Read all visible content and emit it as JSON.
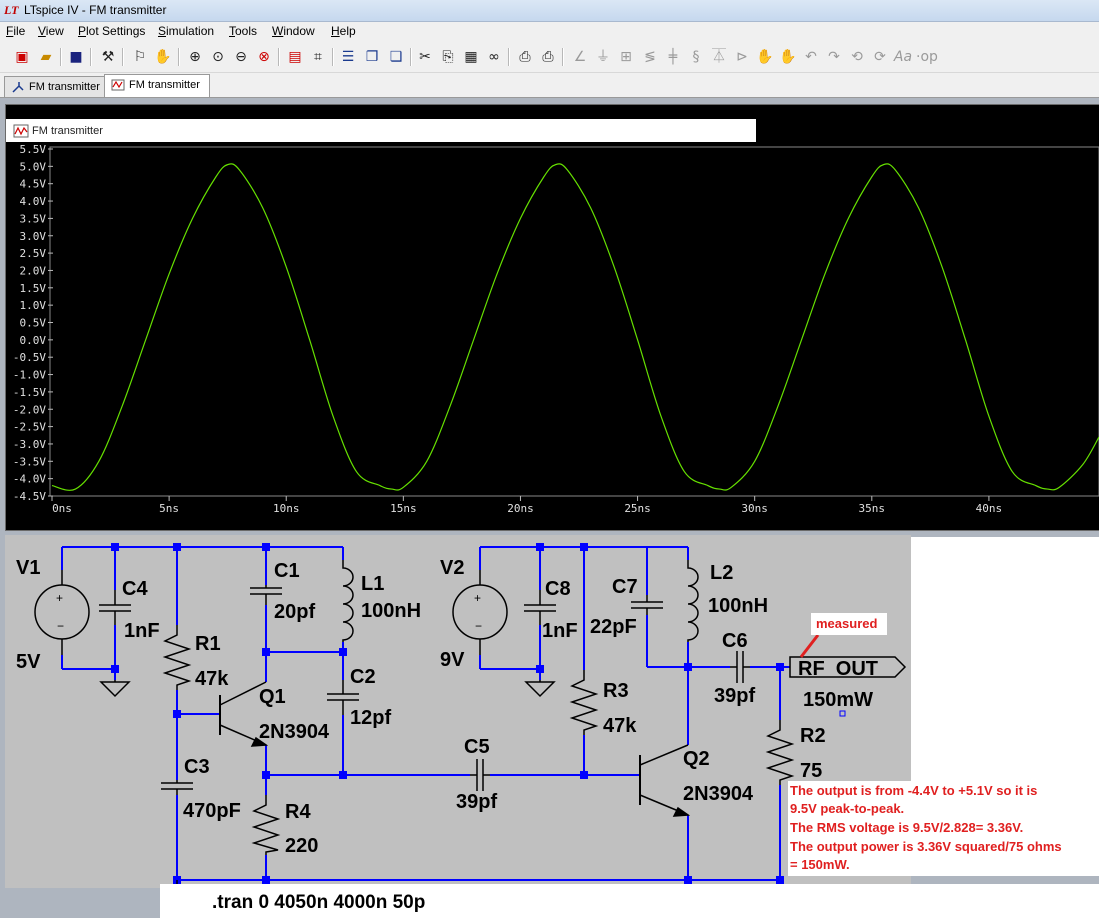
{
  "window": {
    "title": "LTspice IV - FM transmitter"
  },
  "menu": [
    "File",
    "View",
    "Plot Settings",
    "Simulation",
    "Tools",
    "Window",
    "Help"
  ],
  "tabs": [
    {
      "label": "FM transmitter",
      "kind": "schematic"
    },
    {
      "label": "FM transmitter",
      "kind": "waveform",
      "active": true
    }
  ],
  "plot_window": {
    "title": "FM transmitter"
  },
  "colors": {
    "trace": "#66e000",
    "plot_bg": "#000000",
    "schematic_bg": "#c0c0c0",
    "wire": "#0000ff",
    "note_text": "#e02020"
  },
  "chart_data": {
    "type": "line",
    "x_unit": "ns",
    "y_unit": "V",
    "xlim": [
      0,
      44.7
    ],
    "ylim": [
      -4.5,
      5.5
    ],
    "x_ticks": [
      "0ns",
      "5ns",
      "10ns",
      "15ns",
      "20ns",
      "25ns",
      "30ns",
      "35ns",
      "40ns"
    ],
    "x_tick_values": [
      0,
      5,
      10,
      15,
      20,
      25,
      30,
      35,
      40
    ],
    "y_ticks": [
      "5.5V",
      "5.0V",
      "4.5V",
      "4.0V",
      "3.5V",
      "3.0V",
      "2.5V",
      "2.0V",
      "1.5V",
      "1.0V",
      "0.5V",
      "0.0V",
      "-0.5V",
      "-1.0V",
      "-1.5V",
      "-2.0V",
      "-2.5V",
      "-3.0V",
      "-3.5V",
      "-4.0V",
      "-4.5V"
    ],
    "y_tick_values": [
      5.5,
      5.0,
      4.5,
      4.0,
      3.5,
      3.0,
      2.5,
      2.0,
      1.5,
      1.0,
      0.5,
      0.0,
      -0.5,
      -1.0,
      -1.5,
      -2.0,
      -2.5,
      -3.0,
      -3.5,
      -4.0,
      -4.5
    ],
    "grid": false,
    "series": [
      {
        "x": [
          0,
          1,
          2,
          3,
          4,
          5,
          6,
          7,
          7.5,
          8,
          9,
          10,
          11,
          12,
          13,
          14,
          14.5,
          15,
          16,
          17,
          18,
          19,
          20,
          21,
          21.5,
          22,
          23,
          24,
          25,
          26,
          27,
          28,
          28.5,
          29,
          30,
          31,
          32,
          33,
          34,
          35,
          35.5,
          36,
          37,
          38,
          39,
          40,
          41,
          42,
          42.5,
          43,
          44,
          44.7
        ],
        "y": [
          -4.2,
          -4.3,
          -3.5,
          -1.9,
          0.0,
          1.9,
          3.5,
          4.7,
          5.05,
          4.9,
          3.8,
          2.1,
          0.0,
          -2.2,
          -3.8,
          -4.2,
          -4.3,
          -4.25,
          -3.5,
          -1.9,
          0.0,
          1.9,
          3.5,
          4.7,
          5.05,
          4.9,
          3.8,
          2.1,
          0.0,
          -2.2,
          -3.8,
          -4.2,
          -4.3,
          -4.25,
          -3.5,
          -1.9,
          0.0,
          1.9,
          3.5,
          4.7,
          5.05,
          4.9,
          3.8,
          2.1,
          0.0,
          -2.2,
          -3.8,
          -4.2,
          -4.3,
          -4.25,
          -3.6,
          -2.8
        ]
      }
    ]
  },
  "schematic": {
    "labels": {
      "V1": "V1",
      "V1_val": "5V",
      "V2": "V2",
      "V2_val": "9V",
      "C4": "C4",
      "C4_val": "1nF",
      "C8": "C8",
      "C8_val": "1nF",
      "R1": "R1",
      "R1_val": "47k",
      "R3": "R3",
      "R3_val": "47k",
      "C1": "C1",
      "C1_val": "20pf",
      "C7": "C7",
      "C7_val": "22pF",
      "L1": "L1",
      "L1_val": "100nH",
      "L2": "L2",
      "L2_val": "100nH",
      "C2": "C2",
      "C2_val": "12pf",
      "C6": "C6",
      "C6_val": "39pf",
      "Q1": "Q1",
      "Q1_val": "2N3904",
      "Q2": "Q2",
      "Q2_val": "2N3904",
      "C3": "C3",
      "C3_val": "470pF",
      "R4": "R4",
      "R4_val": "220",
      "C5": "C5",
      "C5_val": "39pf",
      "R2": "R2",
      "R2_val": "75",
      "RF_OUT": "RF_OUT",
      "power": "150mW",
      "tran": ".tran 0 4050n 4000n 50p"
    },
    "measured": "measured",
    "note_lines": [
      "The output is from -4.4V to +5.1V so it is",
      "9.5V peak-to-peak.",
      "The RMS voltage is 9.5V/2.828= 3.36V.",
      "The output power is 3.36V squared/75 ohms",
      "= 150mW."
    ]
  }
}
